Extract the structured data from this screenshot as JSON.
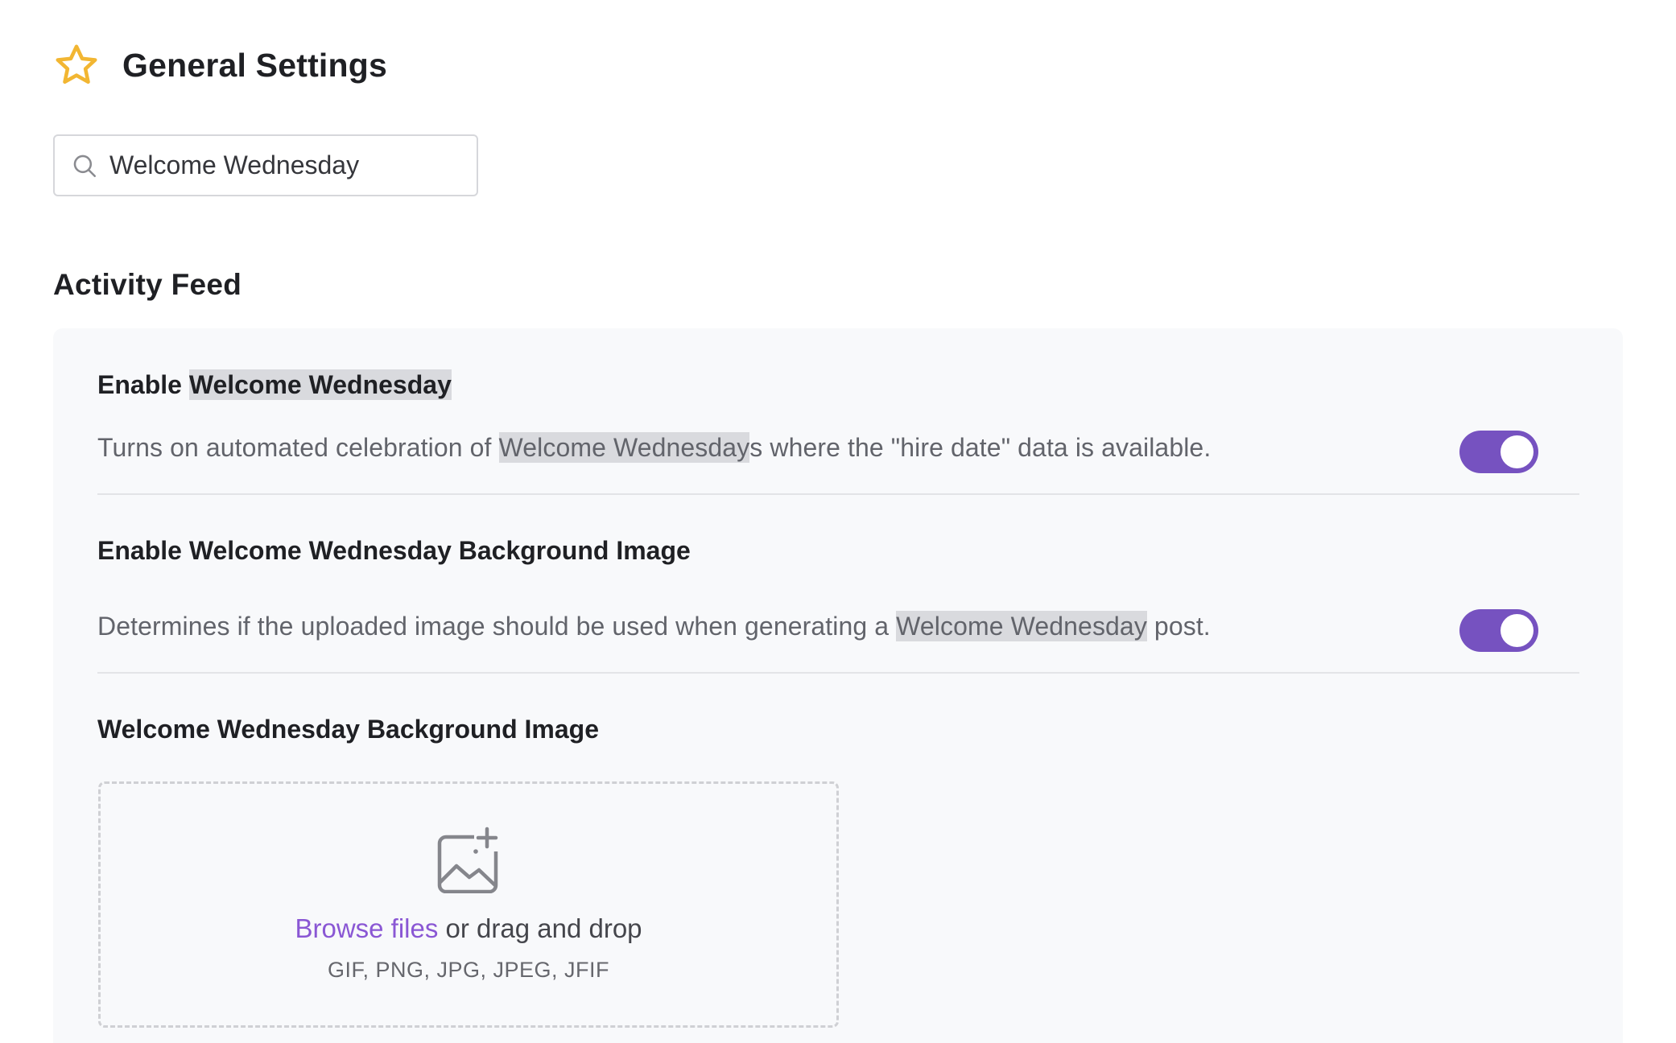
{
  "header": {
    "title": "General Settings",
    "icon": "star-icon"
  },
  "search": {
    "value": "Welcome Wednesday",
    "icon": "search-icon"
  },
  "section": {
    "title": "Activity Feed"
  },
  "settings": [
    {
      "title_prefix": "Enable ",
      "title_highlight": "Welcome Wednesday",
      "desc_prefix": "Turns on automated celebration of ",
      "desc_highlight": "Welcome Wednesday",
      "desc_suffix": "s where the \"hire date\" data is available.",
      "enabled": true
    },
    {
      "title": "Enable Welcome Wednesday Background Image",
      "desc_prefix": "Determines if the uploaded image should be used when generating a ",
      "desc_highlight": "Welcome Wednesday",
      "desc_suffix": " post.",
      "enabled": true
    }
  ],
  "upload": {
    "title": "Welcome Wednesday Background Image",
    "browse_label": "Browse files",
    "drag_text": " or drag and drop",
    "file_types": "GIF, PNG, JPG, JPEG, JFIF",
    "icon": "image-add-icon"
  },
  "colors": {
    "accent": "#7652c0",
    "link": "#8a57d4",
    "star": "#f2b632",
    "highlight": "#d9dade"
  }
}
